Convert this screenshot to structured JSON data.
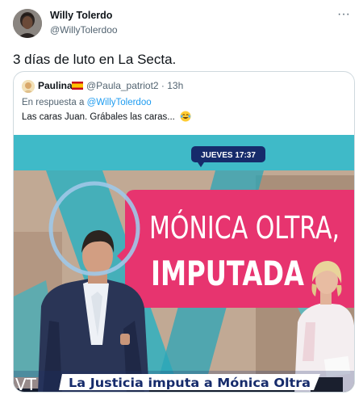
{
  "author": {
    "name": "Willy Tolerdo",
    "handle": "@WillyTolerdoo"
  },
  "tweet_text": "3 días de luto en La Secta.",
  "more_icon": "more-horizontal-icon",
  "quoted": {
    "name": "Paulina",
    "flag": "spain-flag-icon",
    "handle_time": "@Paula_patriot2 · 13h",
    "reply_prefix": "En respuesta a",
    "reply_to": "@WillyTolerdoo",
    "text": "Las caras Juan. Grábales las caras...",
    "emoji": "laughing-crying-emoji-icon"
  },
  "tv": {
    "time_badge": "JUEVES 17:37",
    "headline_line1": "MÓNICA OLTRA,",
    "headline_line2": "IMPUTADA",
    "ticker": "La Justicia imputa a Mónica Oltra",
    "channel_logo": "VT"
  },
  "colors": {
    "text": "#0f1419",
    "muted": "#536471",
    "link": "#1d9bf0",
    "border": "#cfd9de",
    "tv_teal": "#33b6c4",
    "tv_pink": "#e8336d",
    "tv_navy": "#162b6b"
  }
}
